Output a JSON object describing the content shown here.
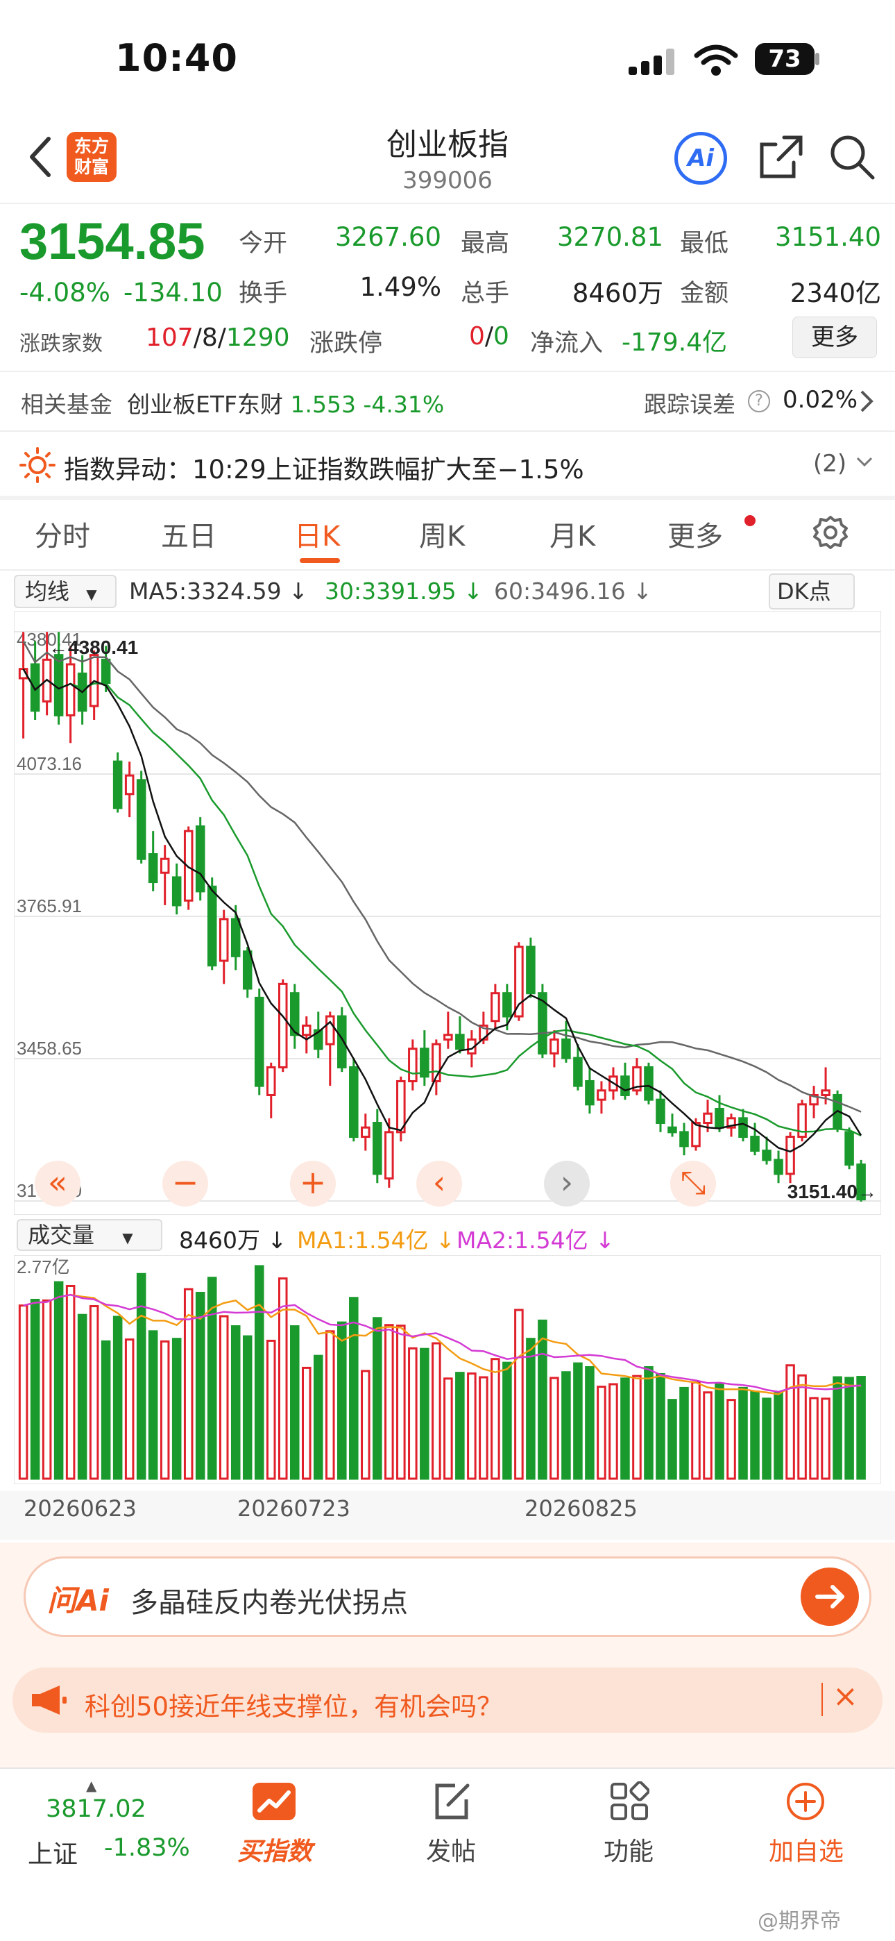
{
  "status_bar": {
    "time": "10:40",
    "battery": "73"
  },
  "header": {
    "title": "创业板指",
    "code": "399006",
    "logo_text_1": "东方",
    "logo_text_2": "财富",
    "ai_label": "Ai"
  },
  "quote": {
    "price": "3154.85",
    "change_pct": "-4.08%",
    "change_abs": "-134.10",
    "open_label": "今开",
    "open_value": "3267.60",
    "high_label": "最高",
    "high_value": "3270.81",
    "low_label": "最低",
    "low_value": "3151.40",
    "turnover_label": "换手",
    "turnover_value": "1.49%",
    "volume_label": "总手",
    "volume_value": "8460万",
    "amount_label": "金额",
    "amount_value": "2340亿",
    "adv_label": "涨跌家数",
    "adv_up": "107",
    "adv_flat": "8",
    "adv_down": "1290",
    "adv_sep": "/",
    "limit_label": "涨跌停",
    "limit_up": "0",
    "limit_down": "0",
    "inflow_label": "净流入",
    "inflow_value": "-179.4亿",
    "more_label": "更多"
  },
  "fund": {
    "label": "相关基金",
    "name": "创业板ETF东财",
    "price": "1.553",
    "change": "-4.31%",
    "tracking_error_label": "跟踪误差",
    "tracking_error_value": "0.02%"
  },
  "alert": {
    "label": "指数异动：",
    "text": "10:29上证指数跌幅扩大至−1.5%",
    "count": "(2)"
  },
  "tabs": [
    {
      "label": "分时",
      "active": false
    },
    {
      "label": "五日",
      "active": false
    },
    {
      "label": "日K",
      "active": true
    },
    {
      "label": "周K",
      "active": false
    },
    {
      "label": "月K",
      "active": false
    },
    {
      "label": "更多",
      "active": false
    }
  ],
  "ma_legend": {
    "selector": "均线",
    "ma5": "MA5:3324.59 ↓",
    "ma30": "30:3391.95 ↓",
    "ma60": "60:3496.16 ↓",
    "dk_label": "DK点"
  },
  "volume_legend": {
    "selector": "成交量",
    "volume": "8460万 ↓",
    "ma1": "MA1:1.54亿 ↓",
    "ma2": "MA2:1.54亿 ↓",
    "top_label": "2.77亿"
  },
  "chart_data": {
    "type": "candlestick",
    "y_ticks": [
      "4380.41",
      "4073.16",
      "3765.91",
      "3458.65",
      "3151.40"
    ],
    "ylim": [
      3151.4,
      4380.41
    ],
    "high_marker": "4380.41",
    "low_marker": "3151.40",
    "x_labels": [
      "20260623",
      "20260723",
      "20260825"
    ],
    "candles": [
      [
        4280,
        4380,
        4150,
        4300
      ],
      [
        4310,
        4360,
        4190,
        4210
      ],
      [
        4230,
        4380,
        4200,
        4320
      ],
      [
        4330,
        4380,
        4180,
        4200
      ],
      [
        4200,
        4350,
        4140,
        4310
      ],
      [
        4290,
        4330,
        4180,
        4210
      ],
      [
        4220,
        4340,
        4190,
        4330
      ],
      [
        4320,
        4350,
        4250,
        4270
      ],
      [
        4100,
        4120,
        3990,
        4000
      ],
      [
        4030,
        4100,
        3980,
        4070
      ],
      [
        4060,
        4080,
        3880,
        3890
      ],
      [
        3900,
        3950,
        3820,
        3840
      ],
      [
        3860,
        3920,
        3790,
        3890
      ],
      [
        3850,
        3880,
        3770,
        3790
      ],
      [
        3800,
        3960,
        3780,
        3950
      ],
      [
        3960,
        3980,
        3800,
        3820
      ],
      [
        3830,
        3850,
        3650,
        3660
      ],
      [
        3670,
        3780,
        3620,
        3760
      ],
      [
        3760,
        3790,
        3650,
        3680
      ],
      [
        3690,
        3700,
        3590,
        3610
      ],
      [
        3590,
        3610,
        3380,
        3400
      ],
      [
        3380,
        3450,
        3330,
        3440
      ],
      [
        3440,
        3630,
        3430,
        3620
      ],
      [
        3600,
        3620,
        3480,
        3510
      ],
      [
        3510,
        3550,
        3470,
        3530
      ],
      [
        3520,
        3560,
        3460,
        3480
      ],
      [
        3490,
        3560,
        3400,
        3550
      ],
      [
        3550,
        3570,
        3430,
        3440
      ],
      [
        3440,
        3460,
        3280,
        3290
      ],
      [
        3290,
        3340,
        3260,
        3310
      ],
      [
        3320,
        3350,
        3190,
        3210
      ],
      [
        3200,
        3330,
        3180,
        3300
      ],
      [
        3300,
        3420,
        3280,
        3410
      ],
      [
        3410,
        3500,
        3390,
        3480
      ],
      [
        3480,
        3520,
        3400,
        3420
      ],
      [
        3410,
        3500,
        3380,
        3490
      ],
      [
        3500,
        3560,
        3480,
        3510
      ],
      [
        3510,
        3550,
        3470,
        3480
      ],
      [
        3470,
        3520,
        3440,
        3500
      ],
      [
        3500,
        3560,
        3490,
        3530
      ],
      [
        3540,
        3620,
        3520,
        3600
      ],
      [
        3600,
        3620,
        3520,
        3550
      ],
      [
        3550,
        3710,
        3540,
        3700
      ],
      [
        3700,
        3720,
        3590,
        3600
      ],
      [
        3600,
        3620,
        3460,
        3470
      ],
      [
        3470,
        3520,
        3440,
        3500
      ],
      [
        3500,
        3540,
        3450,
        3460
      ],
      [
        3460,
        3490,
        3390,
        3400
      ],
      [
        3410,
        3440,
        3340,
        3360
      ],
      [
        3370,
        3410,
        3340,
        3390
      ],
      [
        3390,
        3440,
        3370,
        3420
      ],
      [
        3420,
        3450,
        3370,
        3380
      ],
      [
        3390,
        3460,
        3380,
        3440
      ],
      [
        3440,
        3450,
        3360,
        3370
      ],
      [
        3370,
        3390,
        3300,
        3320
      ],
      [
        3310,
        3340,
        3290,
        3300
      ],
      [
        3300,
        3320,
        3250,
        3270
      ],
      [
        3270,
        3330,
        3260,
        3320
      ],
      [
        3320,
        3370,
        3300,
        3340
      ],
      [
        3350,
        3380,
        3300,
        3310
      ],
      [
        3310,
        3340,
        3290,
        3330
      ],
      [
        3330,
        3350,
        3280,
        3290
      ],
      [
        3290,
        3320,
        3250,
        3260
      ],
      [
        3260,
        3290,
        3230,
        3240
      ],
      [
        3240,
        3260,
        3190,
        3210
      ],
      [
        3210,
        3300,
        3190,
        3290
      ],
      [
        3290,
        3370,
        3280,
        3360
      ],
      [
        3360,
        3400,
        3330,
        3380
      ],
      [
        3380,
        3440,
        3360,
        3390
      ],
      [
        3380,
        3390,
        3300,
        3310
      ],
      [
        3300,
        3310,
        3220,
        3230
      ],
      [
        3230,
        3240,
        3150,
        3155
      ]
    ],
    "volume_ylim": [
      0,
      2.77
    ],
    "volume_unit": "亿"
  },
  "chart_controls": [
    "«",
    "−",
    "+",
    "‹",
    "›",
    "⤡"
  ],
  "ai_bar": {
    "brand": "问Ai",
    "prompt": "多晶硅反内卷光伏拐点"
  },
  "notice": {
    "text": "科创50接近年线支撑位，有机会吗？",
    "close": "×"
  },
  "bottom_nav": {
    "index_price": "3817.02",
    "index_name": "上证",
    "index_change": "-1.83%",
    "items": [
      "买指数",
      "发帖",
      "功能",
      "加自选"
    ]
  },
  "watermark": "@期界帝",
  "colors": {
    "up": "#e0202a",
    "down": "#1a9a2c",
    "accent": "#f05a1f",
    "ma5": "#111111",
    "ma30": "#1a9a2c",
    "ma60": "#666666",
    "vol_ma1": "#f39c12",
    "vol_ma2": "#d43ad4"
  }
}
